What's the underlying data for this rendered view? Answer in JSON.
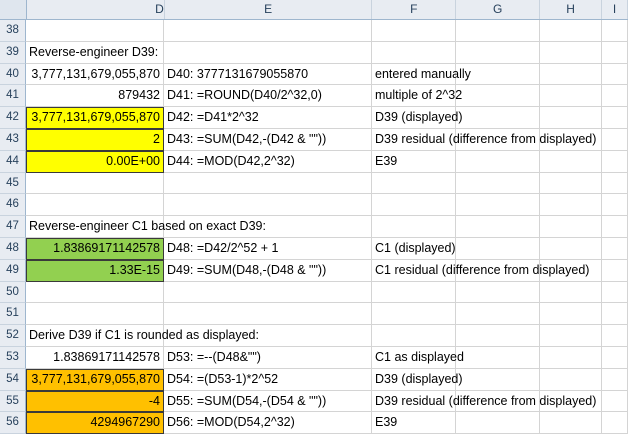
{
  "columns": [
    "D",
    "E",
    "F",
    "G",
    "H",
    "I"
  ],
  "rows": [
    {
      "num": "38",
      "d": "",
      "e": "",
      "f": "",
      "fill": ""
    },
    {
      "num": "39",
      "d": "Reverse-engineer D39:",
      "dLeft": true,
      "e": "",
      "f": "",
      "fill": ""
    },
    {
      "num": "40",
      "d": "3,777,131,679,055,870",
      "e": "D40: 3777131679055870",
      "f": "entered manually",
      "fill": ""
    },
    {
      "num": "41",
      "d": "879432",
      "e": "D41: =ROUND(D40/2^32,0)",
      "f": "multiple of 2^32",
      "fill": ""
    },
    {
      "num": "42",
      "d": "3,777,131,679,055,870",
      "e": "D42: =D41*2^32",
      "f": "D39 (displayed)",
      "fill": "yellow"
    },
    {
      "num": "43",
      "d": "2",
      "e": "D43: =SUM(D42,-(D42 & \"\"))",
      "f": "D39 residual (difference from displayed)",
      "fill": "yellow"
    },
    {
      "num": "44",
      "d": "0.00E+00",
      "e": "D44: =MOD(D42,2^32)",
      "f": "E39",
      "fill": "yellow"
    },
    {
      "num": "45",
      "d": "",
      "e": "",
      "f": "",
      "fill": ""
    },
    {
      "num": "46",
      "d": "",
      "e": "",
      "f": "",
      "fill": ""
    },
    {
      "num": "47",
      "d": "Reverse-engineer C1 based on exact D39:",
      "dLeft": true,
      "e": "",
      "f": "",
      "fill": ""
    },
    {
      "num": "48",
      "d": "1.83869171142578",
      "e": "D48: =D42/2^52 + 1",
      "f": "C1 (displayed)",
      "fill": "green"
    },
    {
      "num": "49",
      "d": "1.33E-15",
      "e": "D49: =SUM(D48,-(D48 & \"\"))",
      "f": "C1 residual (difference from displayed)",
      "fill": "green"
    },
    {
      "num": "50",
      "d": "",
      "e": "",
      "f": "",
      "fill": ""
    },
    {
      "num": "51",
      "d": "",
      "e": "",
      "f": "",
      "fill": ""
    },
    {
      "num": "52",
      "d": "Derive D39 if C1 is rounded as displayed:",
      "dLeft": true,
      "e": "",
      "f": "",
      "fill": ""
    },
    {
      "num": "53",
      "d": "1.83869171142578",
      "e": "D53: =--(D48&\"\")",
      "f": "C1 as displayed",
      "fill": ""
    },
    {
      "num": "54",
      "d": "3,777,131,679,055,870",
      "e": "D54: =(D53-1)*2^52",
      "f": "D39 (displayed)",
      "fill": "orange"
    },
    {
      "num": "55",
      "d": "-4",
      "e": "D55: =SUM(D54,-(D54 & \"\"))",
      "f": "D39 residual (difference from displayed)",
      "fill": "orange"
    },
    {
      "num": "56",
      "d": "4294967290",
      "e": "D56: =MOD(D54,2^32)",
      "f": "E39",
      "fill": "orange"
    }
  ],
  "colors": {
    "yellow": "#ffff00",
    "green": "#92d050",
    "orange": "#ffc000"
  }
}
